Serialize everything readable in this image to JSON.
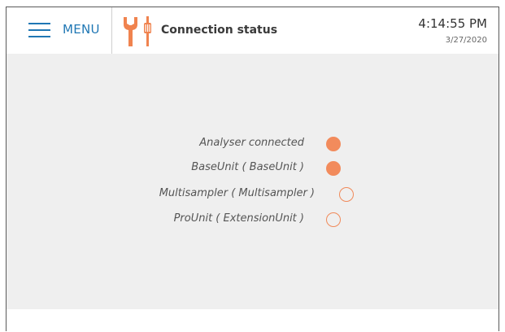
{
  "header": {
    "menu_label": "MENU",
    "menu_icon": "hamburger-icon",
    "page_icon": "wrench-screwdriver-icon",
    "title": "Connection status",
    "time": "4:14:55 PM",
    "date": "3/27/2020"
  },
  "colors": {
    "accent_blue": "#1f77b4",
    "status_orange": "#f28b5c",
    "content_bg": "#efefef"
  },
  "status": {
    "items": [
      {
        "label": "Analyser connected",
        "connected": true
      },
      {
        "label": "BaseUnit ( BaseUnit )",
        "connected": true
      },
      {
        "label": "Multisampler ( Multisampler )",
        "connected": false
      },
      {
        "label": "ProUnit ( ExtensionUnit )",
        "connected": false
      }
    ]
  }
}
